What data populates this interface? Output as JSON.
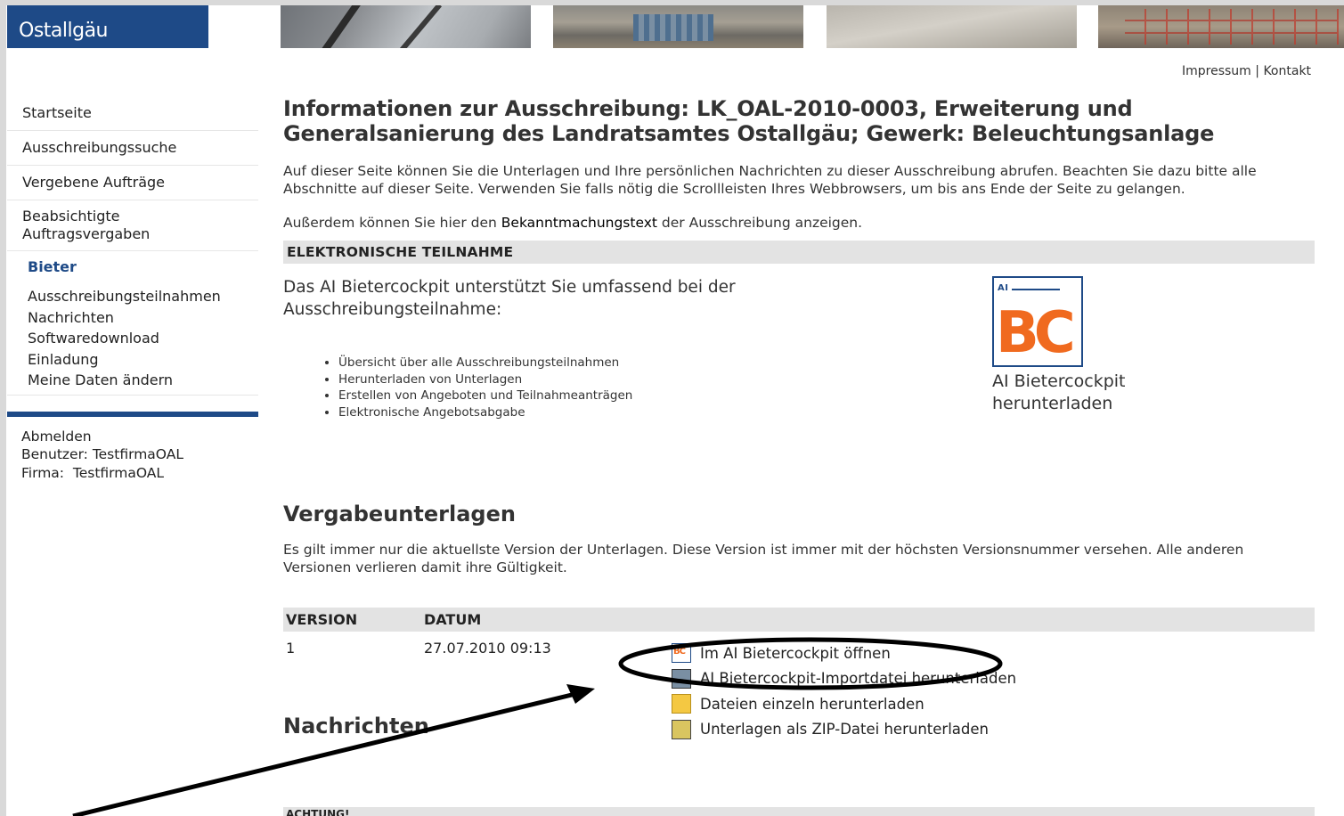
{
  "header": {
    "logo_text": "Ostallgäu",
    "links": [
      "Impressum",
      "Kontakt"
    ],
    "link_sep": " | "
  },
  "sidebar": {
    "items": [
      "Startseite",
      "Ausschreibungssuche",
      "Vergebene Aufträge"
    ],
    "planned_line1": "Beabsichtigte",
    "planned_line2": "Auftragsvergaben",
    "section_heading": "Bieter",
    "sub_items": [
      "Ausschreibungsteilnahmen",
      "Nachrichten",
      "Softwaredownload",
      "Einladung",
      "Meine Daten ändern"
    ],
    "logout": "Abmelden",
    "user_line": "Benutzer: TestfirmaOAL",
    "company_line": "Firma:  TestfirmaOAL"
  },
  "main": {
    "title_line1": "Informationen zur Ausschreibung: LK_OAL-2010-0003, Erweiterung und",
    "title_line2": "Generalsanierung des Landratsamtes Ostallgäu; Gewerk: Beleuchtungsanlage",
    "intro": "Auf dieser Seite können Sie die Unterlagen und Ihre persönlichen Nachrichten zu dieser Ausschreibung abrufen. Beachten Sie dazu bitte alle Abschnitte auf dieser Seite. Verwenden Sie falls nötig die Scrollleisten Ihres Webbrowsers, um bis ans Ende der Seite zu gelangen.",
    "intro2_before": "Außerdem können Sie hier den ",
    "intro2_link": "Bekanntmachungstext",
    "intro2_after": " der Ausschreibung anzeigen."
  },
  "eteilnahme": {
    "header": "ELEKTRONISCHE TEILNAHME",
    "desc": "Das AI Bietercockpit unterstützt Sie umfassend bei der Ausschreibungsteilnahme:",
    "bullets": [
      "Übersicht über alle Ausschreibungsteilnahmen",
      "Herunterladen von Unterlagen",
      "Erstellen von Angeboten und Teilnahmeanträgen",
      "Elektronische Angebotsabgabe"
    ],
    "logo_ai": "AI",
    "logo_bc": "BC",
    "caption_line1": "AI Bietercockpit",
    "caption_line2": "herunterladen"
  },
  "vergabeunterlagen": {
    "heading": "Vergabeunterlagen",
    "text": "Es gilt immer nur die aktuellste Version der Unterlagen. Diese Version ist immer mit der höchsten Versionsnummer versehen. Alle anderen Versionen verlieren damit ihre Gültigkeit.",
    "columns": [
      "VERSION",
      "DATUM"
    ],
    "rows": [
      {
        "version": "1",
        "datum": "27.07.2010 09:13"
      }
    ],
    "actions": [
      {
        "label": "Im AI Bietercockpit öffnen",
        "icon": "bietercockpit-icon"
      },
      {
        "label": "AI Bietercockpit-Importdatei herunterladen",
        "icon": "import-file-icon"
      },
      {
        "label": "Dateien einzeln herunterladen",
        "icon": "folder-files-icon"
      },
      {
        "label": "Unterlagen als ZIP-Datei herunterladen",
        "icon": "zip-archive-icon"
      }
    ]
  },
  "nachrichten": {
    "heading": "Nachrichten",
    "strip_label": "ACHTUNG!"
  },
  "colors": {
    "brand_blue": "#1e4a87",
    "bc_orange": "#f06a1f",
    "section_grey": "#e3e3e3",
    "annotation": "#000000"
  }
}
